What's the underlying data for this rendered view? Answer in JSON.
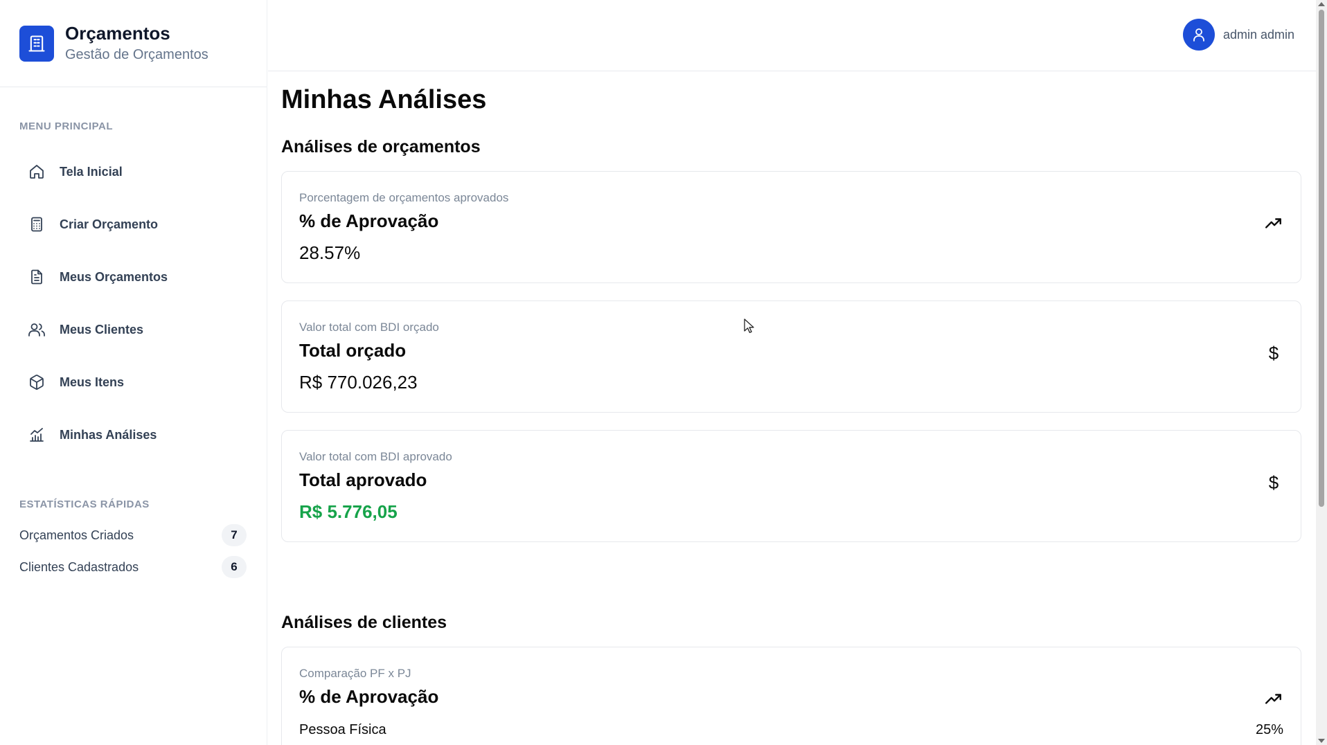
{
  "brand": {
    "title": "Orçamentos",
    "subtitle": "Gestão de Orçamentos",
    "icon": "building-icon",
    "accent": "#1d4ed8"
  },
  "sidebar": {
    "menu_label": "MENU PRINCIPAL",
    "items": [
      {
        "label": "Tela Inicial",
        "icon": "home-icon"
      },
      {
        "label": "Criar Orçamento",
        "icon": "calculator-icon"
      },
      {
        "label": "Meus Orçamentos",
        "icon": "file-text-icon"
      },
      {
        "label": "Meus Clientes",
        "icon": "users-icon"
      },
      {
        "label": "Meus Itens",
        "icon": "package-icon"
      },
      {
        "label": "Minhas Análises",
        "icon": "chart-icon"
      }
    ],
    "stats_label": "ESTATÍSTICAS RÁPIDAS",
    "stats": [
      {
        "label": "Orçamentos Criados",
        "value": "7"
      },
      {
        "label": "Clientes Cadastrados",
        "value": "6"
      }
    ]
  },
  "header": {
    "user_name": "admin admin",
    "avatar_icon": "user-icon"
  },
  "main": {
    "title": "Minhas Análises",
    "budget_section": "Análises de orçamentos",
    "budget_cards": [
      {
        "subtitle": "Porcentagem de orçamentos aprovados",
        "title": "% de Aprovação",
        "value": "28.57%",
        "icon": "trending-up-icon"
      },
      {
        "subtitle": "Valor total com BDI orçado",
        "title": "Total orçado",
        "value": "R$ 770.026,23",
        "icon": "dollar-icon"
      },
      {
        "subtitle": "Valor total com BDI aprovado",
        "title": "Total aprovado",
        "value": "R$ 5.776,05",
        "icon": "dollar-icon"
      }
    ],
    "client_section": "Análises de clientes",
    "client_card": {
      "subtitle": "Comparação PF x PJ",
      "title": "% de Aprovação",
      "icon": "trending-up-icon",
      "row_label": "Pessoa Física",
      "row_value": "25%"
    },
    "dollar_glyph": "$",
    "value_color_green": "#16a34a"
  }
}
